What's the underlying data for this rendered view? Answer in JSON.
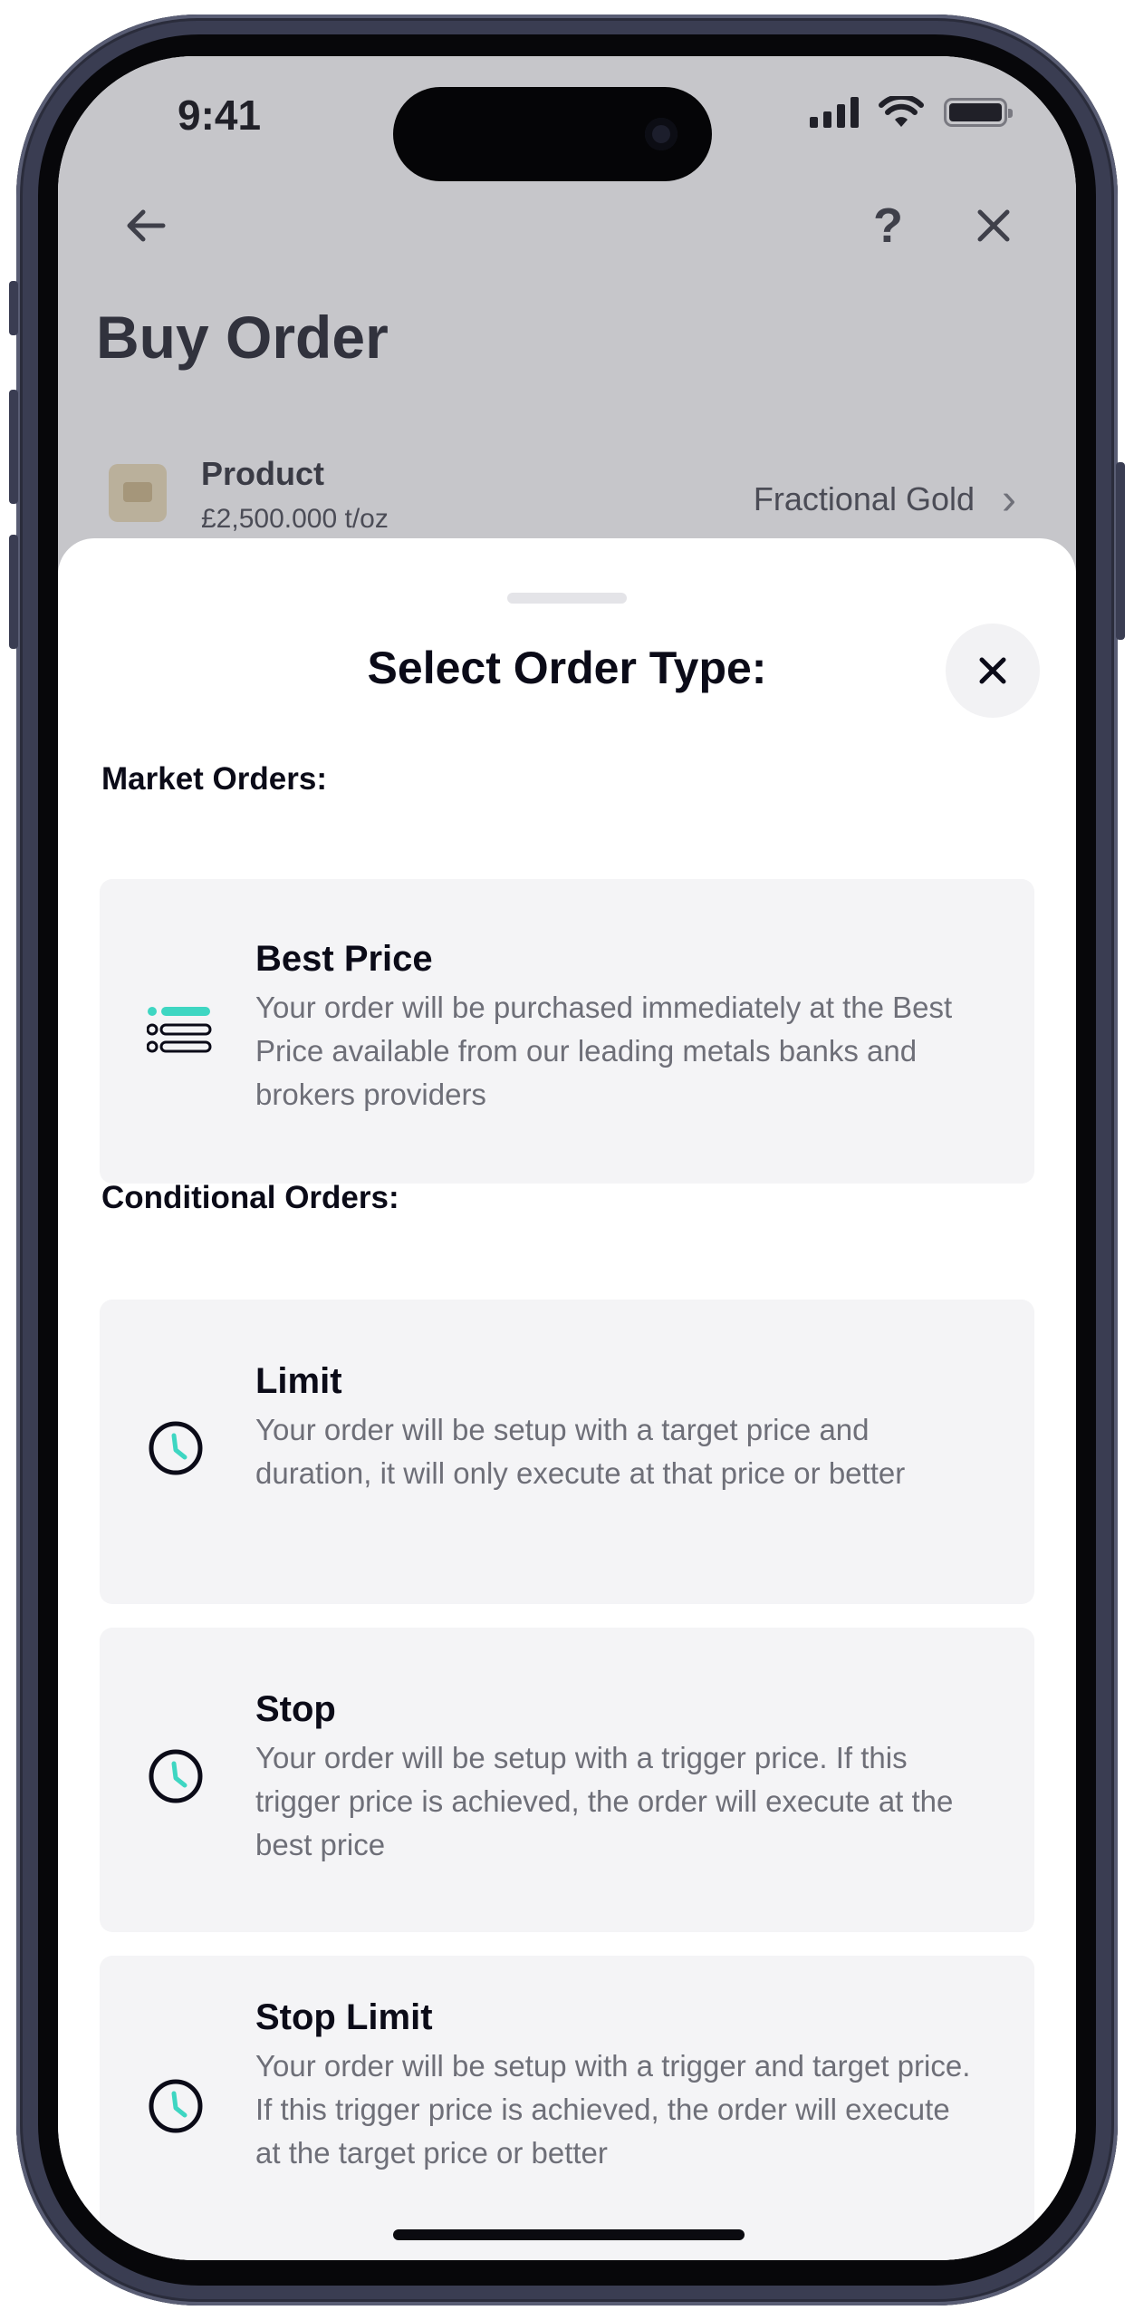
{
  "status_bar": {
    "time": "9:41"
  },
  "background_page": {
    "title": "Buy Order",
    "product_row": {
      "label": "Product",
      "price": "£2,500.000 t/oz",
      "value": "Fractional Gold"
    },
    "icons": {
      "back": "arrow-left-icon",
      "help": "question-mark-icon",
      "close": "close-icon"
    }
  },
  "sheet": {
    "title": "Select Order Type:",
    "close_icon": "close-icon",
    "sections": [
      {
        "label": "Market Orders:",
        "items": [
          {
            "icon": "list-icon",
            "title": "Best Price",
            "description": "Your order will be purchased immediately at the Best Price available from our leading metals banks and brokers providers"
          }
        ]
      },
      {
        "label": "Conditional Orders:",
        "items": [
          {
            "icon": "clock-icon",
            "title": "Limit",
            "description": "Your order will be setup with a target price and duration, it will only execute at that price or better"
          },
          {
            "icon": "clock-icon",
            "title": "Stop",
            "description": "Your order will be setup with a trigger price. If this trigger price is achieved, the order will execute at the best price"
          },
          {
            "icon": "clock-icon",
            "title": "Stop Limit",
            "description": "Your order will be setup with a trigger and target price. If this trigger price is achieved, the order will execute at the target price or better"
          }
        ]
      }
    ]
  },
  "colors": {
    "accent": "#3ed6c2",
    "text_primary": "#0b0b18",
    "text_secondary": "#6e6f78",
    "card_bg": "#f4f4f6"
  }
}
